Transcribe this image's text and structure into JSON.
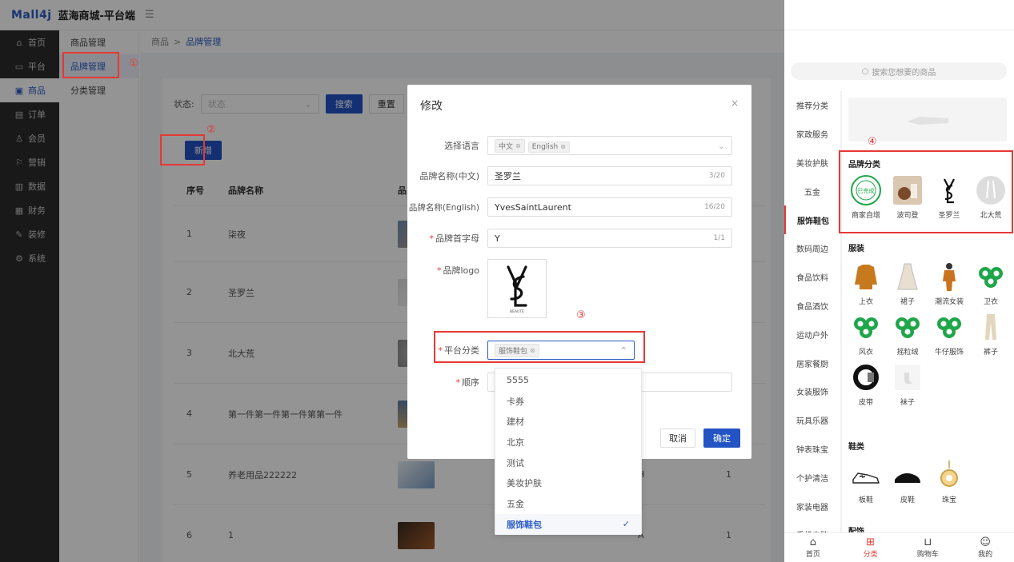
{
  "app": {
    "logo": "Mall4j",
    "title": "蓝海商城-平台端"
  },
  "leftnav": [
    {
      "label": "首页",
      "icon": "home-icon",
      "glyph": "⌂"
    },
    {
      "label": "平台",
      "icon": "monitor-icon",
      "glyph": "▭"
    },
    {
      "label": "商品",
      "icon": "box-icon",
      "glyph": "▣",
      "active": true
    },
    {
      "label": "订单",
      "icon": "document-icon",
      "glyph": "▤"
    },
    {
      "label": "会员",
      "icon": "users-icon",
      "glyph": "♙"
    },
    {
      "label": "营销",
      "icon": "gift-icon",
      "glyph": "⚐"
    },
    {
      "label": "数据",
      "icon": "chart-icon",
      "glyph": "▥"
    },
    {
      "label": "财务",
      "icon": "finance-icon",
      "glyph": "▦"
    },
    {
      "label": "装修",
      "icon": "decorate-icon",
      "glyph": "✎"
    },
    {
      "label": "系统",
      "icon": "settings-icon",
      "glyph": "⚙"
    }
  ],
  "subnav": [
    {
      "label": "商品管理"
    },
    {
      "label": "品牌管理",
      "active": true
    },
    {
      "label": "分类管理"
    }
  ],
  "breadcrumb": {
    "parent": "商品",
    "sep": ">",
    "current": "品牌管理"
  },
  "search": {
    "status_label": "状态:",
    "status_placeholder": "状态",
    "search_btn": "搜索",
    "reset_btn": "重置"
  },
  "add_btn": "新增",
  "table": {
    "headers": {
      "idx": "序号",
      "name": "品牌名称",
      "logo": "品",
      "letter": "",
      "sort": ""
    },
    "rows": [
      {
        "idx": "1",
        "name": "柒夜",
        "letter": "",
        "sort": ""
      },
      {
        "idx": "2",
        "name": "圣罗兰",
        "letter": "",
        "sort": ""
      },
      {
        "idx": "3",
        "name": "北大荒",
        "letter": "",
        "sort": ""
      },
      {
        "idx": "4",
        "name": "第一件第一件第一件第第一件",
        "letter": "",
        "sort": ""
      },
      {
        "idx": "5",
        "name": "养老用品222222",
        "letter": "H",
        "sort": "1"
      },
      {
        "idx": "6",
        "name": "1",
        "letter": "A",
        "sort": "1"
      }
    ]
  },
  "annotations": {
    "n1": "①",
    "n2": "②",
    "n3": "③",
    "n4": "④"
  },
  "modal": {
    "title": "修改",
    "close": "×",
    "lang_label": "选择语言",
    "lang_tags": [
      "中文",
      "English"
    ],
    "name_cn_label": "品牌名称(中文)",
    "name_cn_value": "圣罗兰",
    "name_cn_count": "3/20",
    "name_en_label": "品牌名称(English)",
    "name_en_value": "YvesSaintLaurent",
    "name_en_count": "16/20",
    "letter_label": "品牌首字母",
    "letter_value": "Y",
    "letter_count": "1/1",
    "logo_label": "品牌logo",
    "logo_sub": "BEAUTÉ",
    "category_label": "平台分类",
    "category_tag": "服饰鞋包",
    "sort_label": "顺序",
    "cancel": "取消",
    "confirm": "确定"
  },
  "dropdown": [
    {
      "label": "5555"
    },
    {
      "label": "卡券"
    },
    {
      "label": "建材"
    },
    {
      "label": "北京"
    },
    {
      "label": "测试"
    },
    {
      "label": "美妆护肤"
    },
    {
      "label": "五金"
    },
    {
      "label": "服饰鞋包",
      "selected": true,
      "check": "✓"
    }
  ],
  "mobile": {
    "search_placeholder": "搜索您想要的商品",
    "categories": [
      "推荐分类",
      "家政服务",
      "美妆护肤",
      "五金",
      "服饰鞋包",
      "数码周边",
      "食品饮料",
      "食品酒饮",
      "运动户外",
      "居家餐厨",
      "女装服饰",
      "玩具乐器",
      "钟表珠宝",
      "个护清洁",
      "家装电器",
      "手机电脑"
    ],
    "active_category": "服饰鞋包",
    "brand_title": "品牌分类",
    "brands": [
      "商家自增",
      "波司登",
      "圣罗兰",
      "北大荒"
    ],
    "brand_seal_text": "已完成",
    "clothing_title": "服装",
    "clothing": [
      "上衣",
      "裙子",
      "潮流女装",
      "卫衣",
      "风衣",
      "摇粒绒",
      "牛仔服饰",
      "裤子",
      "皮带",
      "袜子"
    ],
    "shoes_title": "鞋类",
    "shoes": [
      "板鞋",
      "皮鞋",
      "珠宝"
    ],
    "accessory_title": "配饰",
    "tabs": [
      {
        "label": "首页",
        "glyph": "⌂"
      },
      {
        "label": "分类",
        "glyph": "⊞",
        "active": true
      },
      {
        "label": "购物车",
        "glyph": "⊔"
      },
      {
        "label": "我的",
        "glyph": "☺"
      }
    ]
  },
  "colors": {
    "primary": "#2454c4",
    "danger": "#e53935",
    "sidebar": "#2b2b2b",
    "brand_green": "#1fa64a"
  }
}
